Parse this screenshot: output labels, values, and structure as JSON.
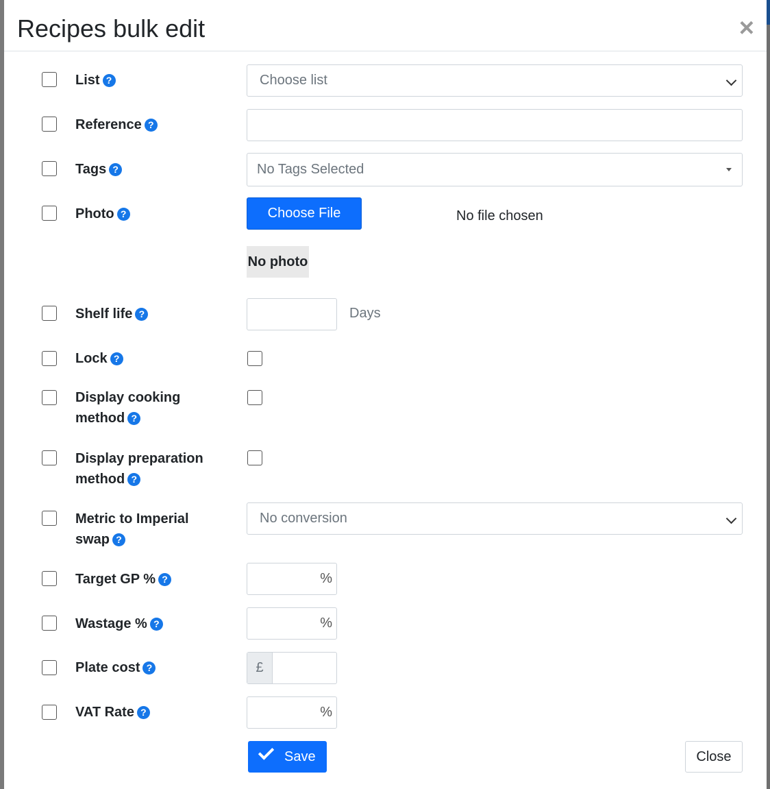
{
  "modal": {
    "title": "Recipes bulk edit",
    "close_glyph": "×"
  },
  "help_glyph": "?",
  "fields": {
    "list": {
      "label": "List",
      "placeholder": "Choose list"
    },
    "reference": {
      "label": "Reference",
      "value": ""
    },
    "tags": {
      "label": "Tags",
      "placeholder": "No Tags Selected"
    },
    "photo": {
      "label": "Photo",
      "button": "Choose File",
      "status": "No file chosen",
      "preview": "No photo"
    },
    "shelf_life": {
      "label": "Shelf life",
      "unit": "Days"
    },
    "lock": {
      "label": "Lock"
    },
    "display_cooking": {
      "label_line1": "Display cooking",
      "label_line2": "method"
    },
    "display_preparation": {
      "label_line1": "Display preparation",
      "label_line2": "method"
    },
    "metric_swap": {
      "label_line1": "Metric to Imperial",
      "label_line2": "swap",
      "selected": "No conversion"
    },
    "target_gp": {
      "label": "Target GP %",
      "unit": "%"
    },
    "wastage": {
      "label": "Wastage %",
      "unit": "%"
    },
    "plate_cost": {
      "label": "Plate cost",
      "prefix": "£"
    },
    "vat_rate": {
      "label": "VAT Rate",
      "unit": "%"
    }
  },
  "footer": {
    "save": "Save",
    "close": "Close"
  },
  "colors": {
    "primary": "#0d6efd",
    "help_icon": "#1677e8"
  }
}
